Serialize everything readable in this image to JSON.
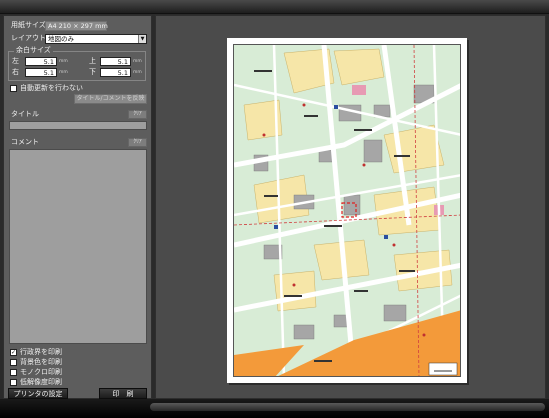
{
  "panel": {
    "paper_size_label": "用紙サイズ",
    "paper_size_value": "A4 210 × 297 mm",
    "layout_label": "レイアウト",
    "layout_value": "地図のみ",
    "margin_group_label": "余白サイズ",
    "margin_left_label": "左",
    "margin_left_value": "5.1",
    "margin_right_label": "右",
    "margin_right_value": "5.1",
    "margin_top_label": "上",
    "margin_top_value": "5.1",
    "margin_bottom_label": "下",
    "margin_bottom_value": "5.1",
    "margin_unit": "mm",
    "auto_refresh_label": "自動更新を行わない",
    "auto_refresh_checked": false,
    "update_title_comment_button": "タイトル/コメントを反映",
    "title_label": "タイトル",
    "title_value": "",
    "title_edit_button": "ｸﾘｱ",
    "comment_label": "コメント",
    "comment_value": "",
    "comment_edit_button": "ｸﾘｱ",
    "options": [
      {
        "label": "行政界を印刷",
        "checked": true
      },
      {
        "label": "背景色を印刷",
        "checked": false
      },
      {
        "label": "モノクロ印刷",
        "checked": false
      },
      {
        "label": "低解像度印刷",
        "checked": false
      }
    ],
    "printer_settings_button": "プリンタの設定",
    "print_button": "印　刷"
  },
  "preview": {
    "background": "#4b4b4b",
    "map_colors": {
      "land": "#d8ecd6",
      "block": "#f6e6a8",
      "building": "#a6a6a6",
      "road": "#ffffff",
      "river": "#f39a3a",
      "boundary": "#d04040"
    }
  }
}
